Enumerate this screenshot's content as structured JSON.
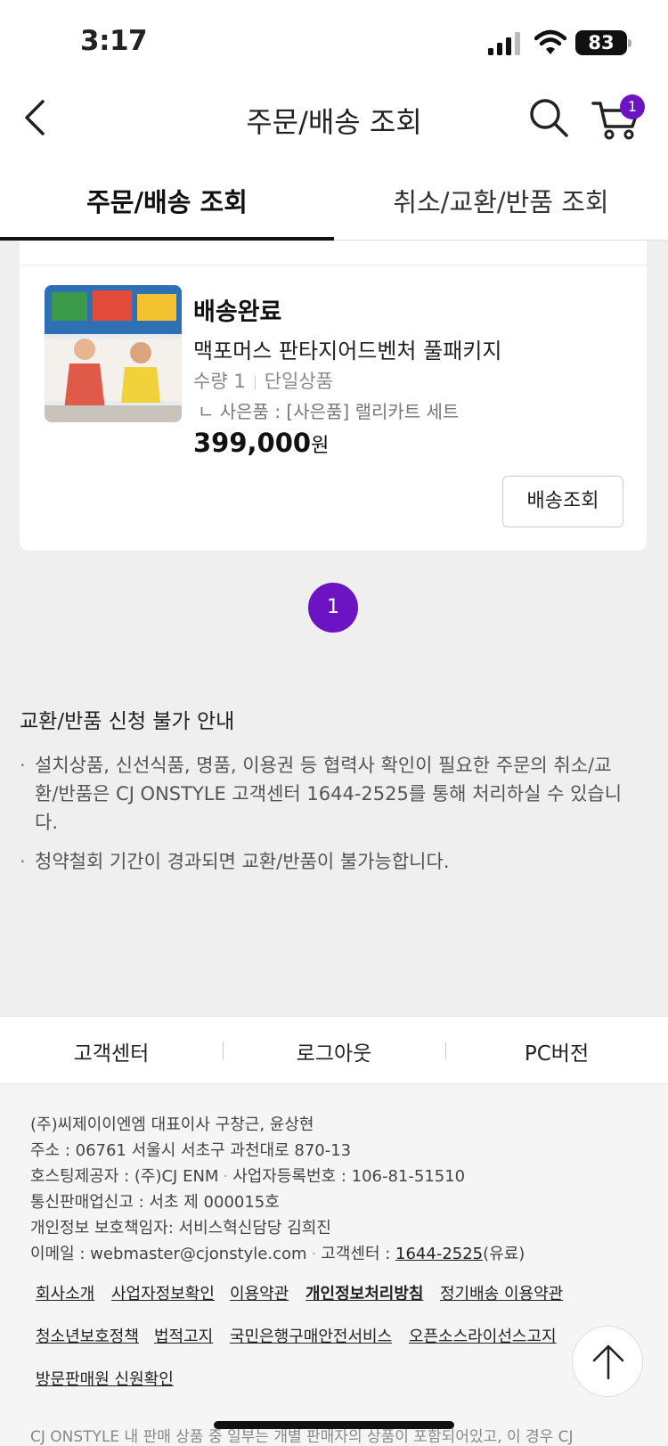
{
  "status_bar": {
    "time": "3:17",
    "battery": "83"
  },
  "header": {
    "title": "주문/배송 조회",
    "cart_count": "1"
  },
  "tabs": [
    {
      "label": "주문/배송 조회",
      "active": true
    },
    {
      "label": "취소/교환/반품 조회",
      "active": false
    }
  ],
  "order": {
    "status": "배송완료",
    "product_name": "맥포머스 판타지어드벤처 풀패키지",
    "quantity": "수량 1",
    "option": "단일상품",
    "gift": "ㄴ 사은품 : [사은품] 랠리카트 세트",
    "price": "399,000",
    "currency": "원",
    "track_button": "배송조회"
  },
  "pagination": {
    "current": "1"
  },
  "notice": {
    "title": "교환/반품 신청 불가 안내",
    "items": [
      "설치상품, 신선식품, 명품, 이용권 등 협력사 확인이 필요한 주문의 취소/교환/반품은 CJ ONSTYLE 고객센터 1644-2525를 통해 처리하실 수 있습니다.",
      "청약철회 기간이 경과되면 교환/반품이 불가능합니다."
    ]
  },
  "footer": {
    "nav": [
      "고객센터",
      "로그아웃",
      "PC버전"
    ],
    "company": "(주)씨제이이엔엠 대표이사 구창근, 윤상현",
    "address": "주소 : 06761 서울시 서초구 과천대로 870-13",
    "hosting": "호스팅제공자 : (주)CJ ENM",
    "biz_no": "사업자등록번호 : 106-81-51510",
    "mail_order": "통신판매업신고 : 서초 제 000015호",
    "privacy_officer": "개인정보 보호책임자: 서비스혁신담당 김희진",
    "email": "이메일 : webmaster@cjonstyle.com",
    "cs_label": "고객센터 : ",
    "cs_phone": "1644-2525",
    "cs_note": "(유료)",
    "links": [
      "회사소개",
      "사업자정보확인",
      "이용약관",
      "개인정보처리방침",
      "정기배송 이용약관",
      "청소년보호정책",
      "법적고지",
      "국민은행구매안전서비스",
      "오픈소스라이선스고지",
      "방문판매원 신원확인"
    ],
    "disclaimer": "CJ ONSTYLE 내 판매 상품 중 일부는 개별 판매자의 상품이 포함되어있고, 이 경우 CJ"
  }
}
